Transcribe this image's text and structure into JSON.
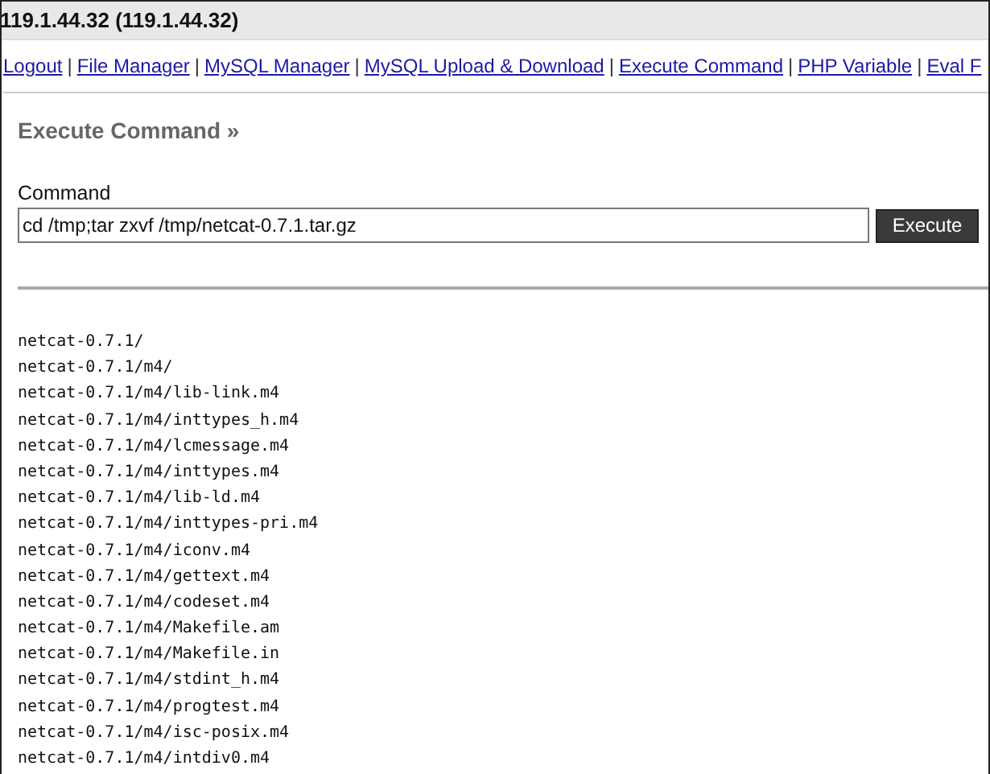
{
  "header": {
    "title": "119.1.44.32 (119.1.44.32)"
  },
  "nav": {
    "links": [
      "Logout",
      "File Manager",
      "MySQL Manager",
      "MySQL Upload & Download",
      "Execute Command",
      "PHP Variable",
      "Eval F"
    ],
    "separator": "|"
  },
  "section": {
    "title": "Execute Command »"
  },
  "command": {
    "label": "Command",
    "value": "cd /tmp;tar zxvf /tmp/netcat-0.7.1.tar.gz",
    "button": "Execute"
  },
  "output": {
    "lines": [
      "netcat-0.7.1/",
      "netcat-0.7.1/m4/",
      "netcat-0.7.1/m4/lib-link.m4",
      "netcat-0.7.1/m4/inttypes_h.m4",
      "netcat-0.7.1/m4/lcmessage.m4",
      "netcat-0.7.1/m4/inttypes.m4",
      "netcat-0.7.1/m4/lib-ld.m4",
      "netcat-0.7.1/m4/inttypes-pri.m4",
      "netcat-0.7.1/m4/iconv.m4",
      "netcat-0.7.1/m4/gettext.m4",
      "netcat-0.7.1/m4/codeset.m4",
      "netcat-0.7.1/m4/Makefile.am",
      "netcat-0.7.1/m4/Makefile.in",
      "netcat-0.7.1/m4/stdint_h.m4",
      "netcat-0.7.1/m4/progtest.m4",
      "netcat-0.7.1/m4/isc-posix.m4",
      "netcat-0.7.1/m4/intdiv0.m4"
    ]
  }
}
